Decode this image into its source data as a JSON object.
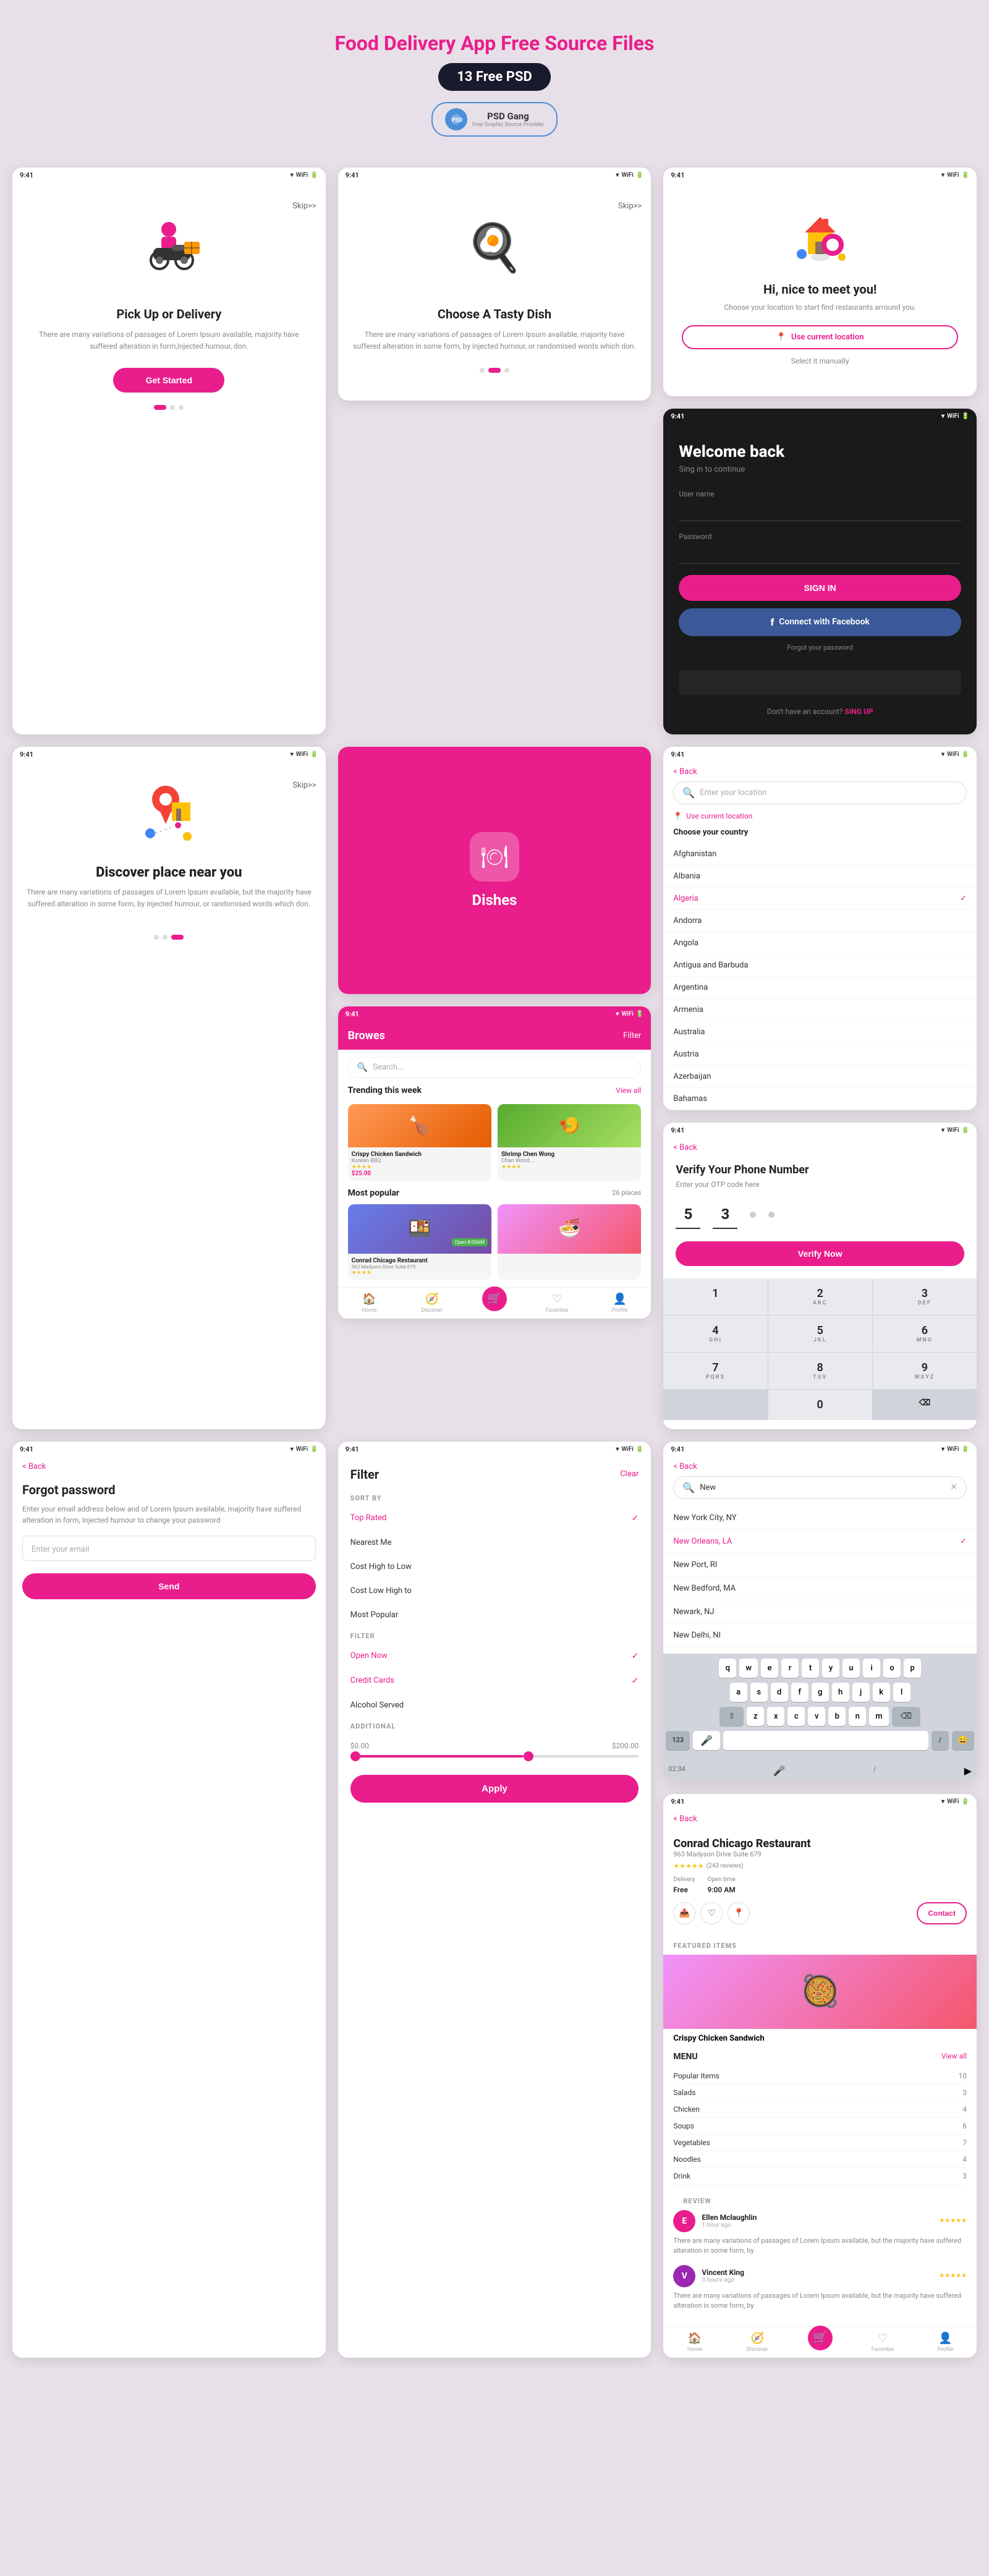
{
  "header": {
    "title": "Food Delivery App\nFree Source Files",
    "badge": "13 Free PSD",
    "psd_gang": "PSD Gang"
  },
  "screens": {
    "onboard1": {
      "time": "9:41",
      "skip": "Skip>>",
      "title": "Pick Up or Delivery",
      "description": "There are many variations of passages of Lorem Ipsum available, majority have suffered alteration in form,Injected humour, don.",
      "cta": "Get Started"
    },
    "onboard2": {
      "time": "9:41",
      "skip": "Skip>>",
      "title": "Choose A Tasty Dish",
      "description": "There are many variations of passages of Lorem Ipsum available, majority have suffered alteration in some form, by injected humour, or randomised words which don.",
      "illustration": "🍳"
    },
    "discover": {
      "time": "9:41",
      "skip": "Skip>>",
      "title": "Discover place near you",
      "description": "There are many variations of passages of Lorem Ipsum available, but the majority have suffered alteration in some form, by injected humour, or randomised words which don."
    },
    "splash": {
      "app_name": "Dishes",
      "icon": "🍽"
    },
    "location_hi": {
      "time": "9:41",
      "title": "Hi, nice to meet  you!",
      "description": "Choose your location to start find restaurants arround you.",
      "use_location": "Use current location",
      "select_manual": "Select it manually"
    },
    "welcome": {
      "time": "9:41",
      "title": "Welcome back",
      "subtitle": "Sing in to continue",
      "username_label": "User name",
      "password_label": "Password",
      "sign_in": "SIGN IN",
      "connect_fb": "Connect with Facebook",
      "forgot": "Forgot your password",
      "no_account": "Don't have an account?",
      "sign_up": "SING UP"
    },
    "location_select": {
      "time": "9:41",
      "back": "< Back",
      "placeholder": "Enter your location",
      "use_current": "Use current location",
      "choose_country": "Choose your country",
      "countries": [
        "Afghanistan",
        "Albania",
        "Algeria",
        "Andorra",
        "Angola",
        "Antigua and Barbuda",
        "Argentina",
        "Armenia",
        "Australia",
        "Austria",
        "Azerbaijan",
        "Bahamas"
      ],
      "selected_country": "Algeria"
    },
    "verify": {
      "time": "9:41",
      "back": "< Back",
      "title": "Verify Your Phone Number",
      "description": "Enter your OTP code here",
      "digits": [
        "5",
        "3",
        "",
        ""
      ],
      "verify_btn": "Verify Now",
      "keys": [
        "1",
        "2\nABC",
        "3\nDEF",
        "4\nGHI",
        "5\nJKL",
        "6\nMNO",
        "7\nPQRS",
        "8\nTUV",
        "9\nWXYZ",
        "",
        "0",
        "⌫"
      ]
    },
    "browse": {
      "time": "9:41",
      "title": "Browes",
      "filter_btn": "Filter",
      "search_placeholder": "Search...",
      "trending_label": "Trending this week",
      "view_all": "View all",
      "most_popular": "Most popular",
      "places_count": "26 places",
      "food_items": [
        {
          "name": "Crispy Chicken Sandwich",
          "sub": "Korean BBQ",
          "stars": "★★★★",
          "price": "$25.00",
          "emoji": "🍗"
        },
        {
          "name": "Shrimp Chen Wong",
          "sub": "Chan Wond...",
          "stars": "★★★★",
          "price": "",
          "emoji": "🍤"
        }
      ],
      "popular_items": [
        {
          "name": "Conrad Chicago Restaurant",
          "addr": "963 Madyson Drive Suite 679",
          "open": "Open 8:00AM",
          "emoji": "🍱"
        },
        {
          "name": "",
          "addr": "",
          "open": "",
          "emoji": "🍜"
        }
      ]
    },
    "forgot": {
      "time": "9:41",
      "back": "< Back",
      "title": "Forgot password",
      "description": "Enter your email address below and of Lorem Ipsum available, majority have suffered alteration in form, Injected humour to change your password",
      "email_placeholder": "Enter your email",
      "send_btn": "Send"
    },
    "search_location": {
      "time": "9:41",
      "back": "< Back",
      "search_value": "New",
      "locations": [
        {
          "name": "New York City, NY",
          "highlighted": false
        },
        {
          "name": "New Orleans, LA",
          "highlighted": true
        },
        {
          "name": "New Port, RI",
          "highlighted": false
        },
        {
          "name": "New Bedford, MA",
          "highlighted": false
        },
        {
          "name": "Newark, NJ",
          "highlighted": false
        },
        {
          "name": "New Delhi, NI",
          "highlighted": false
        }
      ],
      "keyboard_rows": [
        [
          "q",
          "w",
          "e",
          "r",
          "t",
          "y",
          "u",
          "i",
          "o",
          "p"
        ],
        [
          "a",
          "s",
          "d",
          "f",
          "g",
          "h",
          "j",
          "k",
          "l"
        ],
        [
          "z",
          "x",
          "c",
          "v",
          "b",
          "n",
          "m"
        ]
      ]
    },
    "filter": {
      "time": "9:41",
      "title": "Filter",
      "clear": "Clear",
      "sort_by_label": "SORT BY",
      "sort_options": [
        "Top Rated",
        "Nearest Me",
        "Cost High to Low",
        "Cost  Low High to",
        "Most Popular"
      ],
      "selected_sort": "Top Rated",
      "filter_label": "FILTER",
      "filter_options": [
        "Open Now",
        "Credit Cards",
        "Alcohol Served"
      ],
      "selected_filters": [
        "Open Now",
        "Credit Cards"
      ],
      "additional_label": "ADDITIONAL",
      "price_min": "$0.00",
      "price_max": "$200.00",
      "apply_btn": "Apply"
    },
    "restaurant": {
      "time": "9:41",
      "back": "< Back",
      "name": "Conrad Chicago Restaurant",
      "address": "963 Madyson Drive Suite 679",
      "stars": "★★★★★",
      "reviews": "(243 reviews)",
      "delivery_label": "Delivery",
      "delivery_price": "Free",
      "opentime_label": "Open time",
      "open_time": "9:00 AM",
      "contact": "Contact",
      "featured_label": "FEATURED ITEMS",
      "featured_item": "Crispy Chicken Sandwich",
      "menu_label": "MENU",
      "view_all": "View all",
      "menu_items": [
        {
          "name": "Popular Items",
          "count": "10"
        },
        {
          "name": "Salads",
          "count": "3"
        },
        {
          "name": "Chicken",
          "count": "4"
        },
        {
          "name": "Soups",
          "count": "6"
        },
        {
          "name": "Vegetables",
          "count": "7"
        },
        {
          "name": "Noodles",
          "count": "4"
        },
        {
          "name": "Drink",
          "count": "3"
        }
      ],
      "review_label": "REVIEW",
      "reviewers": [
        {
          "name": "Ellen Mclaughlin",
          "time": "1 hour ago",
          "stars": "★★★★★",
          "text": "There are many variations of passages of Lorem Ipsum available, but the majority have suffered alteration in some form, by",
          "initial": "E"
        },
        {
          "name": "Vincent King",
          "time": "3 hours ago",
          "stars": "★★★★★",
          "text": "There are many variations of passages of Lorem Ipsum available, but the majority have suffered alteration in some form, by",
          "initial": "V"
        }
      ]
    },
    "bottom_nav": {
      "items": [
        "Home",
        "Discover",
        "Cart",
        "Favorites",
        "Profile"
      ],
      "active": "Cart"
    }
  }
}
